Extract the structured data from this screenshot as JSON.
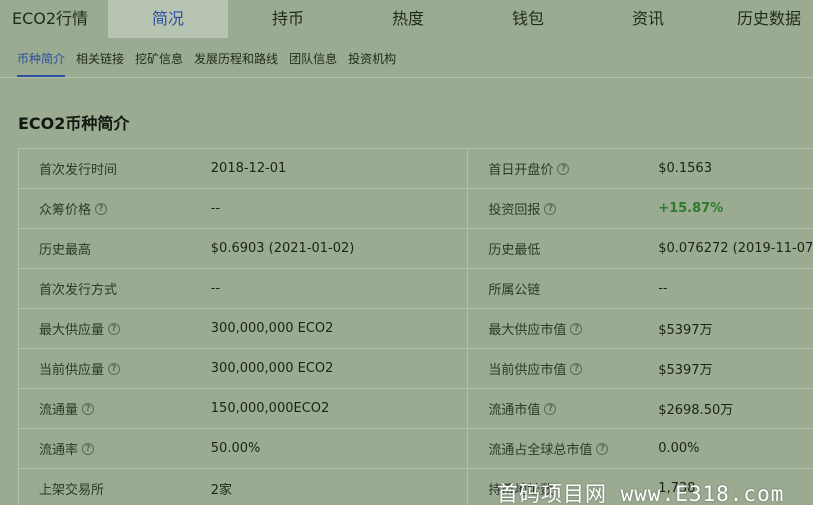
{
  "top_tabs": [
    "ECO2行情",
    "简况",
    "持币",
    "热度",
    "钱包",
    "资讯",
    "历史数据"
  ],
  "sub_tabs": [
    "币种简介",
    "相关链接",
    "挖矿信息",
    "发展历程和路线",
    "团队信息",
    "投资机构"
  ],
  "section_title": "ECO2币种简介",
  "rows": [
    {
      "l_label": "首次发行时间",
      "l_help": false,
      "l_value": "2018-12-01",
      "r_label": "首日开盘价",
      "r_help": true,
      "r_value": "$0.1563"
    },
    {
      "l_label": "众筹价格",
      "l_help": true,
      "l_value": "--",
      "r_label": "投资回报",
      "r_help": true,
      "r_value": "+15.87%"
    },
    {
      "l_label": "历史最高",
      "l_help": false,
      "l_value": "$0.6903 (2021-01-02)",
      "r_label": "历史最低",
      "r_help": false,
      "r_value": "$0.076272 (2019-11-07)"
    },
    {
      "l_label": "首次发行方式",
      "l_help": false,
      "l_value": "--",
      "r_label": "所属公链",
      "r_help": false,
      "r_value": "--"
    },
    {
      "l_label": "最大供应量",
      "l_help": true,
      "l_value": "300,000,000 ECO2",
      "r_label": "最大供应市值",
      "r_help": true,
      "r_value": "$5397万"
    },
    {
      "l_label": "当前供应量",
      "l_help": true,
      "l_value": "300,000,000 ECO2",
      "r_label": "当前供应市值",
      "r_help": true,
      "r_value": "$5397万"
    },
    {
      "l_label": "流通量",
      "l_help": true,
      "l_value": "150,000,000ECO2",
      "r_label": "流通市值",
      "r_help": true,
      "r_value": "$2698.50万"
    },
    {
      "l_label": "流通率",
      "l_help": true,
      "l_value": "50.00%",
      "r_label": "流通占全球总市值",
      "r_help": true,
      "r_value": "0.00%"
    },
    {
      "l_label": "上架交易所",
      "l_help": false,
      "l_value": "2家",
      "r_label": "持币地址数",
      "r_help": false,
      "r_value": "1,738"
    }
  ],
  "help_glyph": "?",
  "watermark": "首码项目网 www.E318.com",
  "colors": {
    "background": "#9aab92",
    "active_tab": "#2c4fa0",
    "positive": "#2d7a2d"
  }
}
